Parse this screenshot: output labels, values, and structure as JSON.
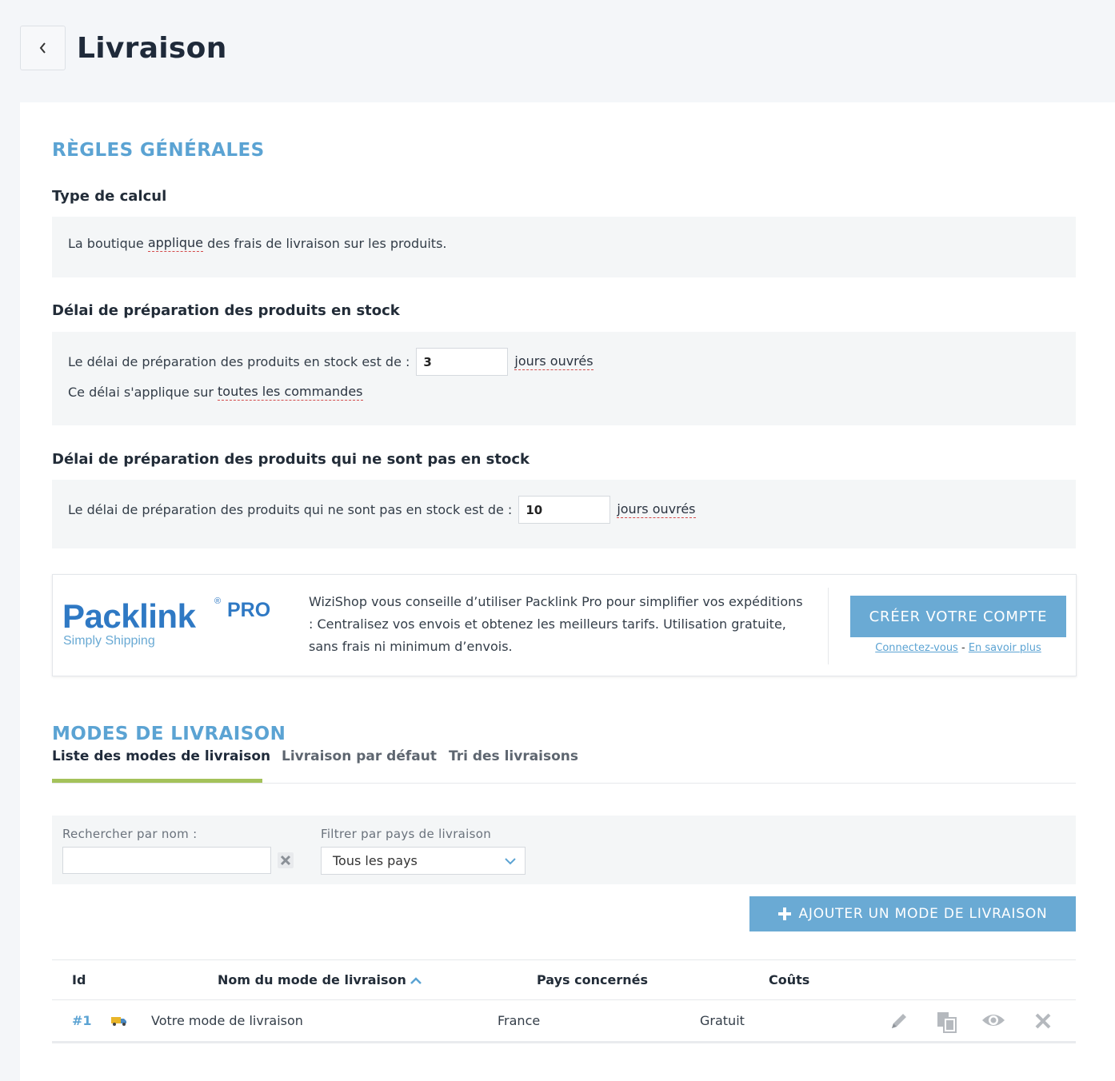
{
  "header": {
    "title": "Livraison"
  },
  "general": {
    "section_title": "RÈGLES GÉNÉRALES",
    "calc_type": {
      "title": "Type de calcul",
      "text_before": "La boutique",
      "link": "applique",
      "text_after": "des frais de livraison sur les produits."
    },
    "in_stock": {
      "title": "Délai de préparation des produits en stock",
      "label": "Le délai de préparation des produits en stock est de :",
      "value": "3",
      "unit": "jours ouvrés",
      "applies_text": "Ce délai s'applique sur",
      "applies_link": "toutes les commandes"
    },
    "out_stock": {
      "title": "Délai de préparation des produits qui ne sont pas en stock",
      "label": "Le délai de préparation des produits qui ne sont pas en stock est de :",
      "value": "10",
      "unit": "jours ouvrés"
    }
  },
  "packlink": {
    "logo_main": "Packlink",
    "logo_reg": "®",
    "logo_pro": "PRO",
    "logo_tagline": "Simply Shipping",
    "text": "WiziShop vous conseille d’utiliser Packlink Pro pour simplifier vos expéditions : Centralisez vos envois et obtenez les meilleurs tarifs. Utilisation gratuite, sans frais ni minimum d’envois.",
    "cta": "CRÉER VOTRE COMPTE",
    "link_login": "Connectez-vous",
    "link_sep": "-",
    "link_more": "En savoir plus"
  },
  "modes": {
    "section_title": "MODES DE LIVRAISON",
    "tabs": [
      {
        "label": "Liste des modes de livraison",
        "active": true
      },
      {
        "label": "Livraison par défaut",
        "active": false
      },
      {
        "label": "Tri des livraisons",
        "active": false
      }
    ],
    "filters": {
      "search_label": "Rechercher par nom :",
      "search_value": "",
      "country_label": "Filtrer par pays de livraison",
      "country_selected": "Tous les pays"
    },
    "add_button": "AJOUTER UN MODE DE LIVRAISON",
    "table": {
      "headers": {
        "id": "Id",
        "name": "Nom du mode de livraison",
        "countries": "Pays concernés",
        "costs": "Coûts"
      },
      "rows": [
        {
          "id": "#1",
          "icon": "truck-icon",
          "name": "Votre mode de livraison",
          "countries": "France",
          "costs": "Gratuit"
        }
      ]
    }
  },
  "colors": {
    "accent": "#5ba3d3",
    "button": "#6aaad4",
    "tab_underline": "#a4c25a",
    "packlink_blue": "#2f79c4"
  }
}
